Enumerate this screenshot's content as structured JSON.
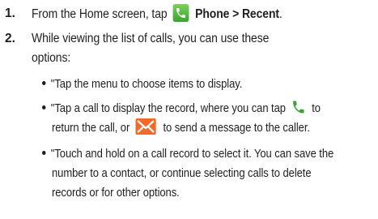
{
  "steps": [
    {
      "number": "1.",
      "text_before": "From the Home screen, tap",
      "icon": "phone-app-icon",
      "bold_text": "Phone > Recent",
      "text_after": "."
    },
    {
      "number": "2.",
      "line1": "While viewing the list of calls, you can use these",
      "line2": "options:"
    }
  ],
  "bullets": [
    {
      "line1": "\"Tap the menu to choose items to display."
    },
    {
      "line1_before": "\"Tap a call to display the record, where you can tap",
      "call_icon": "phone-handset-icon",
      "line1_after": "to",
      "line2_before": "return the call, or",
      "message_icon": "envelope-icon",
      "line2_after": "to send a message to the caller."
    },
    {
      "line1": "\"Touch and hold on a call record to select it. You can save the",
      "line2": "number to a contact, or continue selecting calls to delete",
      "line3": "records or for other options."
    }
  ],
  "colors": {
    "text": "#1f1f1f",
    "phone_icon_green": "#3aa334",
    "message_icon_orange": "#f26a2a"
  }
}
